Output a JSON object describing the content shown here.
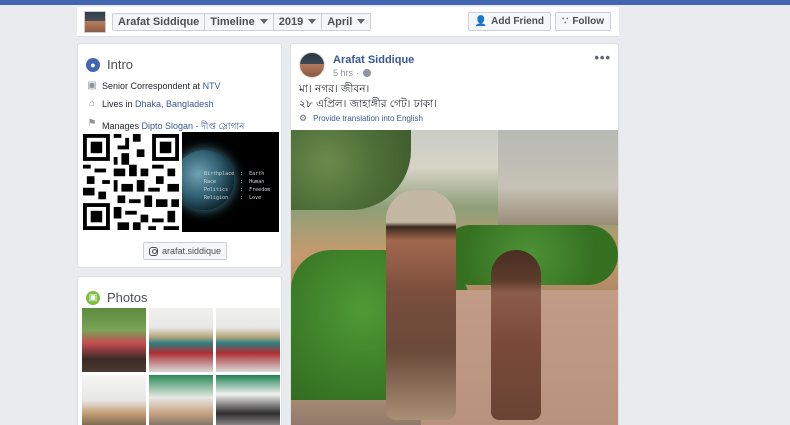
{
  "nav": {
    "name": "Arafat Siddique",
    "timeline": "Timeline",
    "year": "2019",
    "month": "April",
    "add_friend": "Add Friend",
    "follow": "Follow"
  },
  "intro": {
    "title": "Intro",
    "items": [
      {
        "icon": "briefcase-icon",
        "prefix": "Senior Correspondent at ",
        "link": "NTV"
      },
      {
        "icon": "home-icon",
        "prefix": "Lives in ",
        "link": "Dhaka, Bangladesh"
      },
      {
        "icon": "flag-icon",
        "prefix": "Manages ",
        "link": "Dipto Slogan - দীপ্ত স্লোগান"
      }
    ],
    "instagram": "arafat.siddique"
  },
  "photos": {
    "title": "Photos"
  },
  "post": {
    "author": "Arafat Siddique",
    "time": "5 hrs",
    "line1": "মা। নগর। জীবন।",
    "line2": "২৮ এপ্রিল। জাহাঙ্গীর গেট। ঢাকা।",
    "translate": "Provide translation into English",
    "more": "•••"
  },
  "colors": {
    "brand": "#4267b2",
    "link": "#385898"
  }
}
